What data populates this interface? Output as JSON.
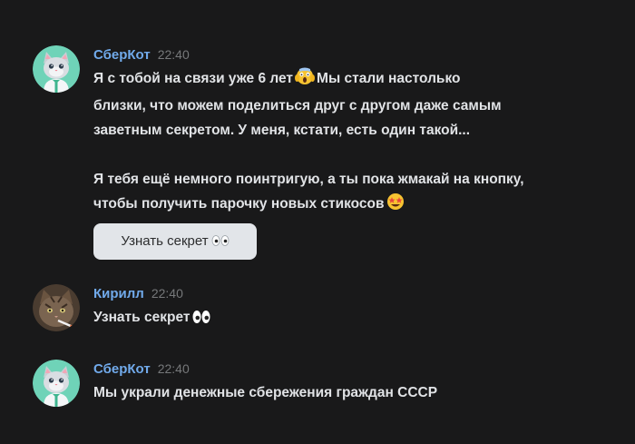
{
  "messages": [
    {
      "author": "СберКот",
      "time": "22:40",
      "lines": {
        "l1a": "Я с тобой на связи уже 6 лет",
        "l1b": "Мы стали настолько",
        "l2": "близки, что можем поделиться друг с другом даже самым",
        "l3": "заветным секретом. У меня, кстати, есть один такой...",
        "l4": "Я тебя ещё немного поинтригую, а ты пока жмакай на кнопку,",
        "l5": "чтобы получить парочку новых стикосов"
      },
      "button_label": "Узнать секрет"
    },
    {
      "author": "Кирилл",
      "time": "22:40",
      "text": "Узнать секрет"
    },
    {
      "author": "СберКот",
      "time": "22:40",
      "text": "Мы украли денежные сбережения граждан СССР"
    }
  ],
  "colors": {
    "background": "#19191a",
    "author": "#71aaeb",
    "time": "#76787a",
    "text": "#e1e3e6",
    "button_bg": "#e2e5e9"
  },
  "icons": {
    "screaming_face": "screaming-face-emoji",
    "star_struck": "star-struck-emoji",
    "eyes": "eyes-emoji"
  }
}
